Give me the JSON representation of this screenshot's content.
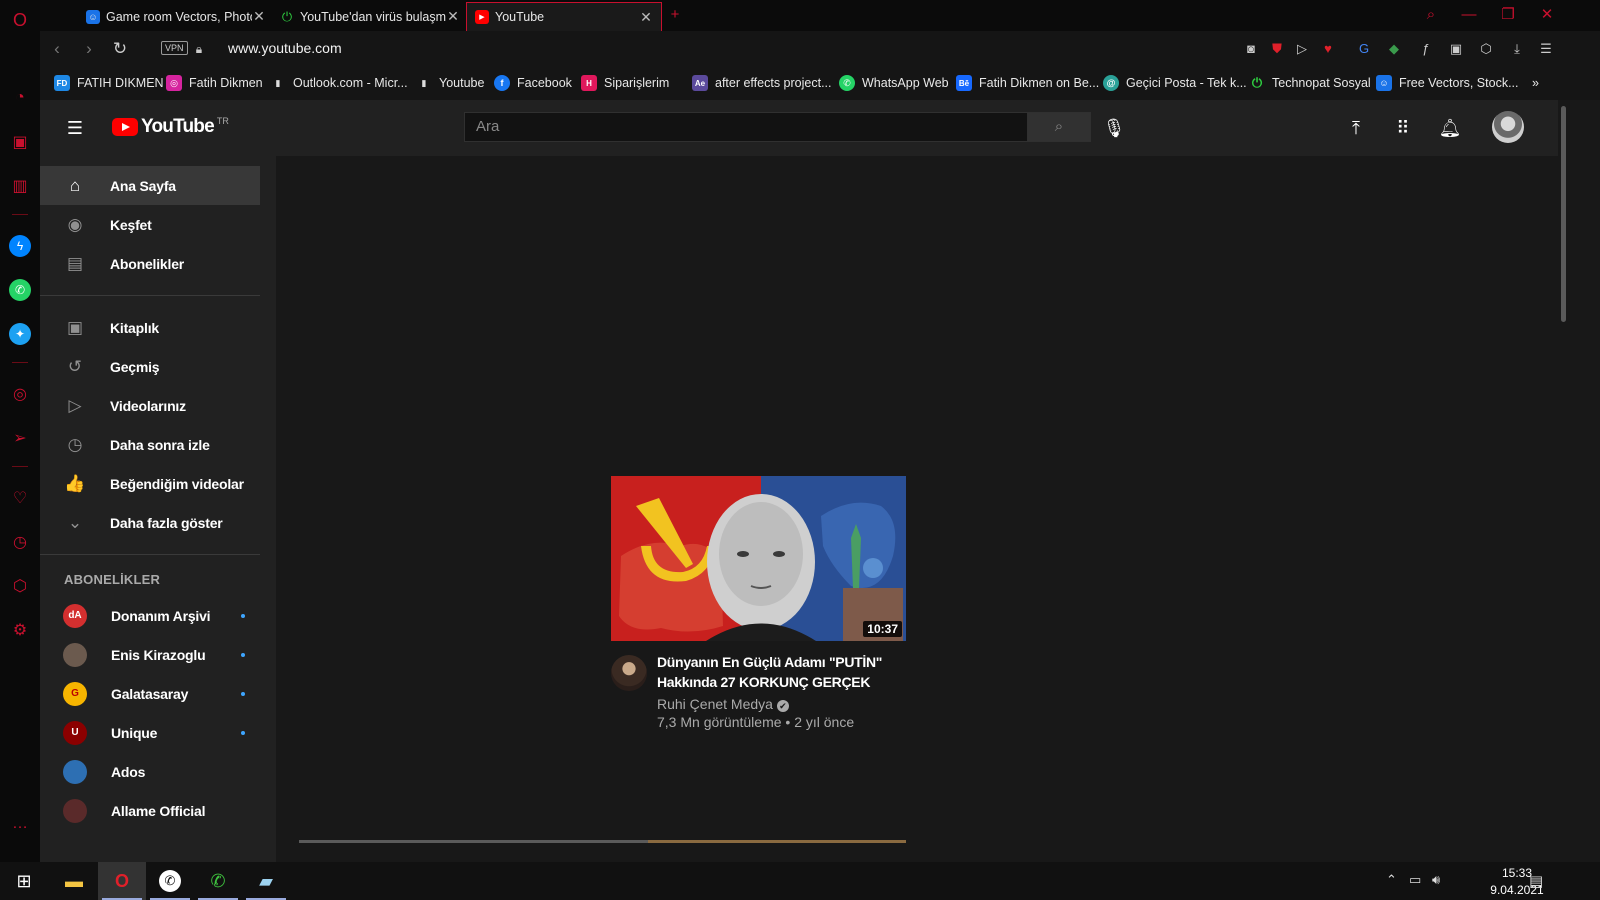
{
  "browser": {
    "tabs": [
      {
        "title": "Game room Vectors, Photos",
        "favicon": "freepik-icon",
        "color": "#1a73e8"
      },
      {
        "title": "YouTube'dan virüs bulaşma",
        "favicon": "technopat-icon",
        "color": "#2ecc40"
      },
      {
        "title": "YouTube",
        "favicon": "youtube-icon",
        "color": "#ff0000",
        "active": true
      }
    ],
    "new_tab_label": "+",
    "url": "www.youtube.com",
    "vpn_label": "VPN",
    "bookmarks": [
      {
        "label": "FATIH DIKMEN",
        "icon": "FD",
        "color": "#1e88e5"
      },
      {
        "label": "Fatih Dikmen",
        "icon": "◎",
        "color": "#d6249f"
      },
      {
        "label": "Outlook.com - Micr...",
        "icon": "▮",
        "color": "#d0d0d0"
      },
      {
        "label": "Youtube",
        "icon": "▮",
        "color": "#d0d0d0"
      },
      {
        "label": "Facebook",
        "icon": "f",
        "color": "#1877f2"
      },
      {
        "label": "Siparişlerim",
        "icon": "H",
        "color": "#e0185c"
      },
      {
        "label": "after effects project...",
        "icon": "Ae",
        "color": "#5b4a9c"
      },
      {
        "label": "WhatsApp Web",
        "icon": "✆",
        "color": "#25d366"
      },
      {
        "label": "Fatih Dikmen on Be...",
        "icon": "Bē",
        "color": "#1769ff"
      },
      {
        "label": "Geçici Posta - Tek k...",
        "icon": "@",
        "color": "#2aa198"
      },
      {
        "label": "Technopat Sosyal",
        "icon": "⏻",
        "color": "#2ecc40"
      },
      {
        "label": "Free Vectors, Stock...",
        "icon": "☺",
        "color": "#1a73e8"
      }
    ]
  },
  "youtube": {
    "logo_text": "YouTube",
    "country_code": "TR",
    "search_placeholder": "Ara",
    "guide": {
      "main": [
        {
          "label": "Ana Sayfa",
          "icon": "home-icon",
          "glyph": "⌂",
          "active": true
        },
        {
          "label": "Keşfet",
          "icon": "compass-icon",
          "glyph": "◉"
        },
        {
          "label": "Abonelikler",
          "icon": "subscriptions-icon",
          "glyph": "▤"
        }
      ],
      "library": [
        {
          "label": "Kitaplık",
          "icon": "library-icon",
          "glyph": "▣"
        },
        {
          "label": "Geçmiş",
          "icon": "history-icon",
          "glyph": "↺"
        },
        {
          "label": "Videolarınız",
          "icon": "your-videos-icon",
          "glyph": "▷"
        },
        {
          "label": "Daha sonra izle",
          "icon": "watch-later-icon",
          "glyph": "◷"
        },
        {
          "label": "Beğendiğim videolar",
          "icon": "thumbs-up-icon",
          "glyph": "👍"
        },
        {
          "label": "Daha fazla göster",
          "icon": "chevron-down-icon",
          "glyph": "⌄"
        }
      ],
      "subscriptions_title": "ABONELİKLER",
      "subscriptions": [
        {
          "label": "Donanım Arşivi",
          "color": "#d32f2f",
          "badge": "dA",
          "new": true
        },
        {
          "label": "Enis Kirazoglu",
          "color": "#6b5a4e",
          "badge": "",
          "new": true
        },
        {
          "label": "Galatasaray",
          "color": "#f7b500",
          "badge": "G",
          "new": true
        },
        {
          "label": "Unique",
          "color": "#8b0000",
          "badge": "U",
          "new": true
        },
        {
          "label": "Ados",
          "color": "#2d6fb3",
          "badge": "",
          "new": false
        },
        {
          "label": "Allame Official",
          "color": "#5a2a2a",
          "badge": "",
          "new": false
        }
      ]
    },
    "video": {
      "title": "Dünyanın En Güçlü Adamı \"PUTİN\" Hakkında 27 KORKUNÇ GERÇEK",
      "channel": "Ruhi Çenet Medya",
      "verified_icon": "✔",
      "meta": "7,3 Mn görüntüleme • 2 yıl önce",
      "duration": "10:37"
    }
  },
  "taskbar": {
    "time": "15:33",
    "date": "9.04.2021"
  }
}
